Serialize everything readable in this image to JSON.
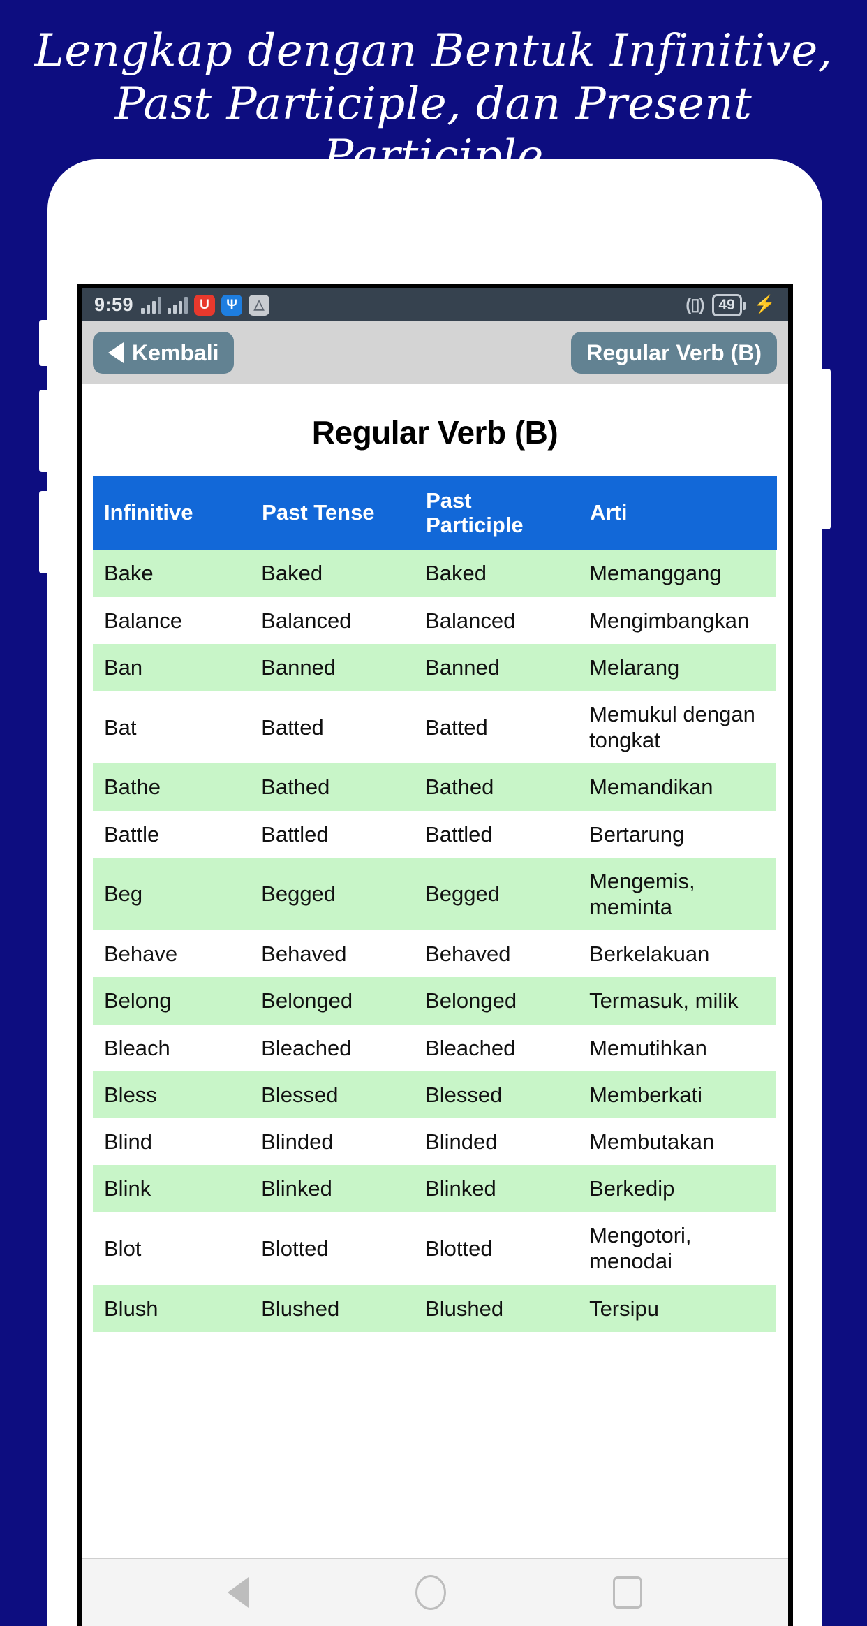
{
  "promo": {
    "heading": "Lengkap dengan Bentuk Infinitive,\nPast Participle, dan Present Participle"
  },
  "colors": {
    "background": "#0d0d80",
    "table_header": "#1268d8",
    "row_alt": "#c8f5c8",
    "navbar_button": "#628292",
    "navbar_bg": "#d4d4d4",
    "status_bar": "#36424f"
  },
  "status_bar": {
    "time": "9:59",
    "signal_1": "signal-bars-icon",
    "signal_2": "signal-bars-icon",
    "app_icon_1": "U",
    "app_icon_2": "usb-icon",
    "app_icon_3": "photo-icon",
    "vibrate": "vibrate-icon",
    "battery_level": "49",
    "charging": "charging-bolt-icon"
  },
  "app_navbar": {
    "back_label": "Kembali",
    "title_label": "Regular Verb (B)"
  },
  "page": {
    "title": "Regular Verb (B)"
  },
  "table": {
    "headers": [
      "Infinitive",
      "Past Tense",
      "Past Participle",
      "Arti"
    ],
    "rows": [
      {
        "infinitive": "Bake",
        "past_tense": "Baked",
        "past_participle": "Baked",
        "arti": "Memanggang"
      },
      {
        "infinitive": "Balance",
        "past_tense": "Balanced",
        "past_participle": "Balanced",
        "arti": "Mengimbangkan"
      },
      {
        "infinitive": "Ban",
        "past_tense": "Banned",
        "past_participle": "Banned",
        "arti": "Melarang"
      },
      {
        "infinitive": "Bat",
        "past_tense": "Batted",
        "past_participle": "Batted",
        "arti": "Memukul dengan tongkat"
      },
      {
        "infinitive": "Bathe",
        "past_tense": "Bathed",
        "past_participle": "Bathed",
        "arti": "Memandikan"
      },
      {
        "infinitive": "Battle",
        "past_tense": "Battled",
        "past_participle": "Battled",
        "arti": "Bertarung"
      },
      {
        "infinitive": "Beg",
        "past_tense": "Begged",
        "past_participle": "Begged",
        "arti": "Mengemis, meminta"
      },
      {
        "infinitive": "Behave",
        "past_tense": "Behaved",
        "past_participle": "Behaved",
        "arti": "Berkelakuan"
      },
      {
        "infinitive": "Belong",
        "past_tense": "Belonged",
        "past_participle": "Belonged",
        "arti": "Termasuk, milik"
      },
      {
        "infinitive": "Bleach",
        "past_tense": "Bleached",
        "past_participle": "Bleached",
        "arti": "Memutihkan"
      },
      {
        "infinitive": "Bless",
        "past_tense": "Blessed",
        "past_participle": "Blessed",
        "arti": "Memberkati"
      },
      {
        "infinitive": "Blind",
        "past_tense": "Blinded",
        "past_participle": "Blinded",
        "arti": "Membutakan"
      },
      {
        "infinitive": "Blink",
        "past_tense": "Blinked",
        "past_participle": "Blinked",
        "arti": "Berkedip"
      },
      {
        "infinitive": "Blot",
        "past_tense": "Blotted",
        "past_participle": "Blotted",
        "arti": "Mengotori, menodai"
      },
      {
        "infinitive": "Blush",
        "past_tense": "Blushed",
        "past_participle": "Blushed",
        "arti": "Tersipu"
      }
    ]
  },
  "softkeys": {
    "back": "back-triangle-icon",
    "home": "home-circle-icon",
    "recent": "recents-square-icon"
  }
}
